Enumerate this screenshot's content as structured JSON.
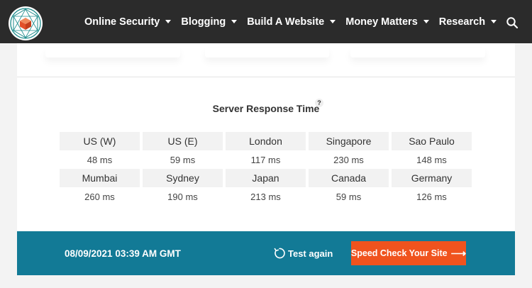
{
  "nav": {
    "items": [
      {
        "label": "Online Security"
      },
      {
        "label": "Blogging"
      },
      {
        "label": "Build A Website"
      },
      {
        "label": "Money Matters"
      },
      {
        "label": "Research"
      }
    ],
    "search_icon": "search-icon",
    "logo_icon": "cube-logo-icon"
  },
  "panel": {
    "title": "Server Response Time",
    "help": "?",
    "rows": [
      [
        {
          "location": "US (W)",
          "time": "48 ms"
        },
        {
          "location": "US (E)",
          "time": "59 ms"
        },
        {
          "location": "London",
          "time": "117 ms"
        },
        {
          "location": "Singapore",
          "time": "230 ms"
        },
        {
          "location": "Sao Paulo",
          "time": "148 ms"
        }
      ],
      [
        {
          "location": "Mumbai",
          "time": "260 ms"
        },
        {
          "location": "Sydney",
          "time": "190 ms"
        },
        {
          "location": "Japan",
          "time": "213 ms"
        },
        {
          "location": "Canada",
          "time": "59 ms"
        },
        {
          "location": "Germany",
          "time": "126 ms"
        }
      ]
    ]
  },
  "footer": {
    "timestamp": "08/09/2021 03:39 AM GMT",
    "retest_label": "Test again",
    "cta_label": "Speed Check Your Site",
    "cta_arrow": "⟶"
  },
  "colors": {
    "topbar": "#2b2b2b",
    "footer": "#127a96",
    "cta": "#f0531e",
    "logo": "#1a8a8a"
  }
}
